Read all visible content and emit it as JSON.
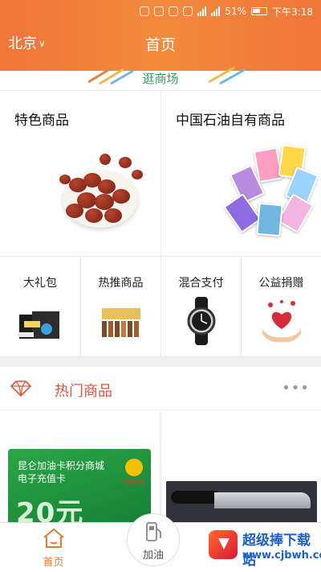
{
  "status_bar": {
    "battery": "51%",
    "time": "下午3:18"
  },
  "header": {
    "city": "北京",
    "title": "首页"
  },
  "mall": {
    "label": "逛商场"
  },
  "featured": [
    {
      "title": "特色商品"
    },
    {
      "title": "中国石油自有商品"
    }
  ],
  "categories": [
    {
      "label": "大礼包"
    },
    {
      "label": "热推商品"
    },
    {
      "label": "混合支付"
    },
    {
      "label": "公益捐赠"
    }
  ],
  "hot": {
    "title": "热门商品",
    "more": "•••"
  },
  "products": [
    {
      "line1": "昆仑加油卡积分商城",
      "line2": "电子充值卡",
      "amount": "20元",
      "logo_text": "中国石油"
    }
  ],
  "bottom_nav": [
    {
      "label": "首页",
      "active": true
    },
    {
      "label": "加油",
      "active": false
    }
  ],
  "watermark": {
    "title": "超级捧下载站",
    "url": "www.cjbwh.com"
  },
  "colors": {
    "header": "#f0763a",
    "accent": "#e47a2e",
    "hot_title": "#e0533a",
    "mall_label": "#3b9a57"
  }
}
